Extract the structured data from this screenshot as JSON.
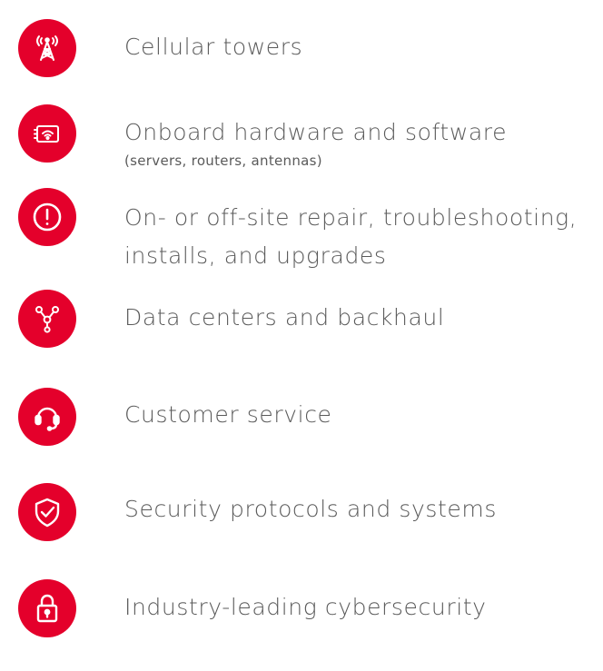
{
  "colors": {
    "accent": "#e4002b",
    "text": "#5a5a5a",
    "icon_stroke": "#ffffff"
  },
  "items": [
    {
      "icon": "cell-tower-icon",
      "label": "Cellular towers"
    },
    {
      "icon": "router-wifi-icon",
      "label": "Onboard hardware and software",
      "sublabel": "(servers, routers, antennas)"
    },
    {
      "icon": "exclamation-icon",
      "label": "On- or off-site repair, troubleshooting, installs, and upgrades"
    },
    {
      "icon": "network-nodes-icon",
      "label": "Data centers and backhaul"
    },
    {
      "icon": "headset-icon",
      "label": "Customer service"
    },
    {
      "icon": "shield-check-icon",
      "label": "Security protocols and systems"
    },
    {
      "icon": "padlock-icon",
      "label": "Industry-leading cybersecurity"
    }
  ]
}
